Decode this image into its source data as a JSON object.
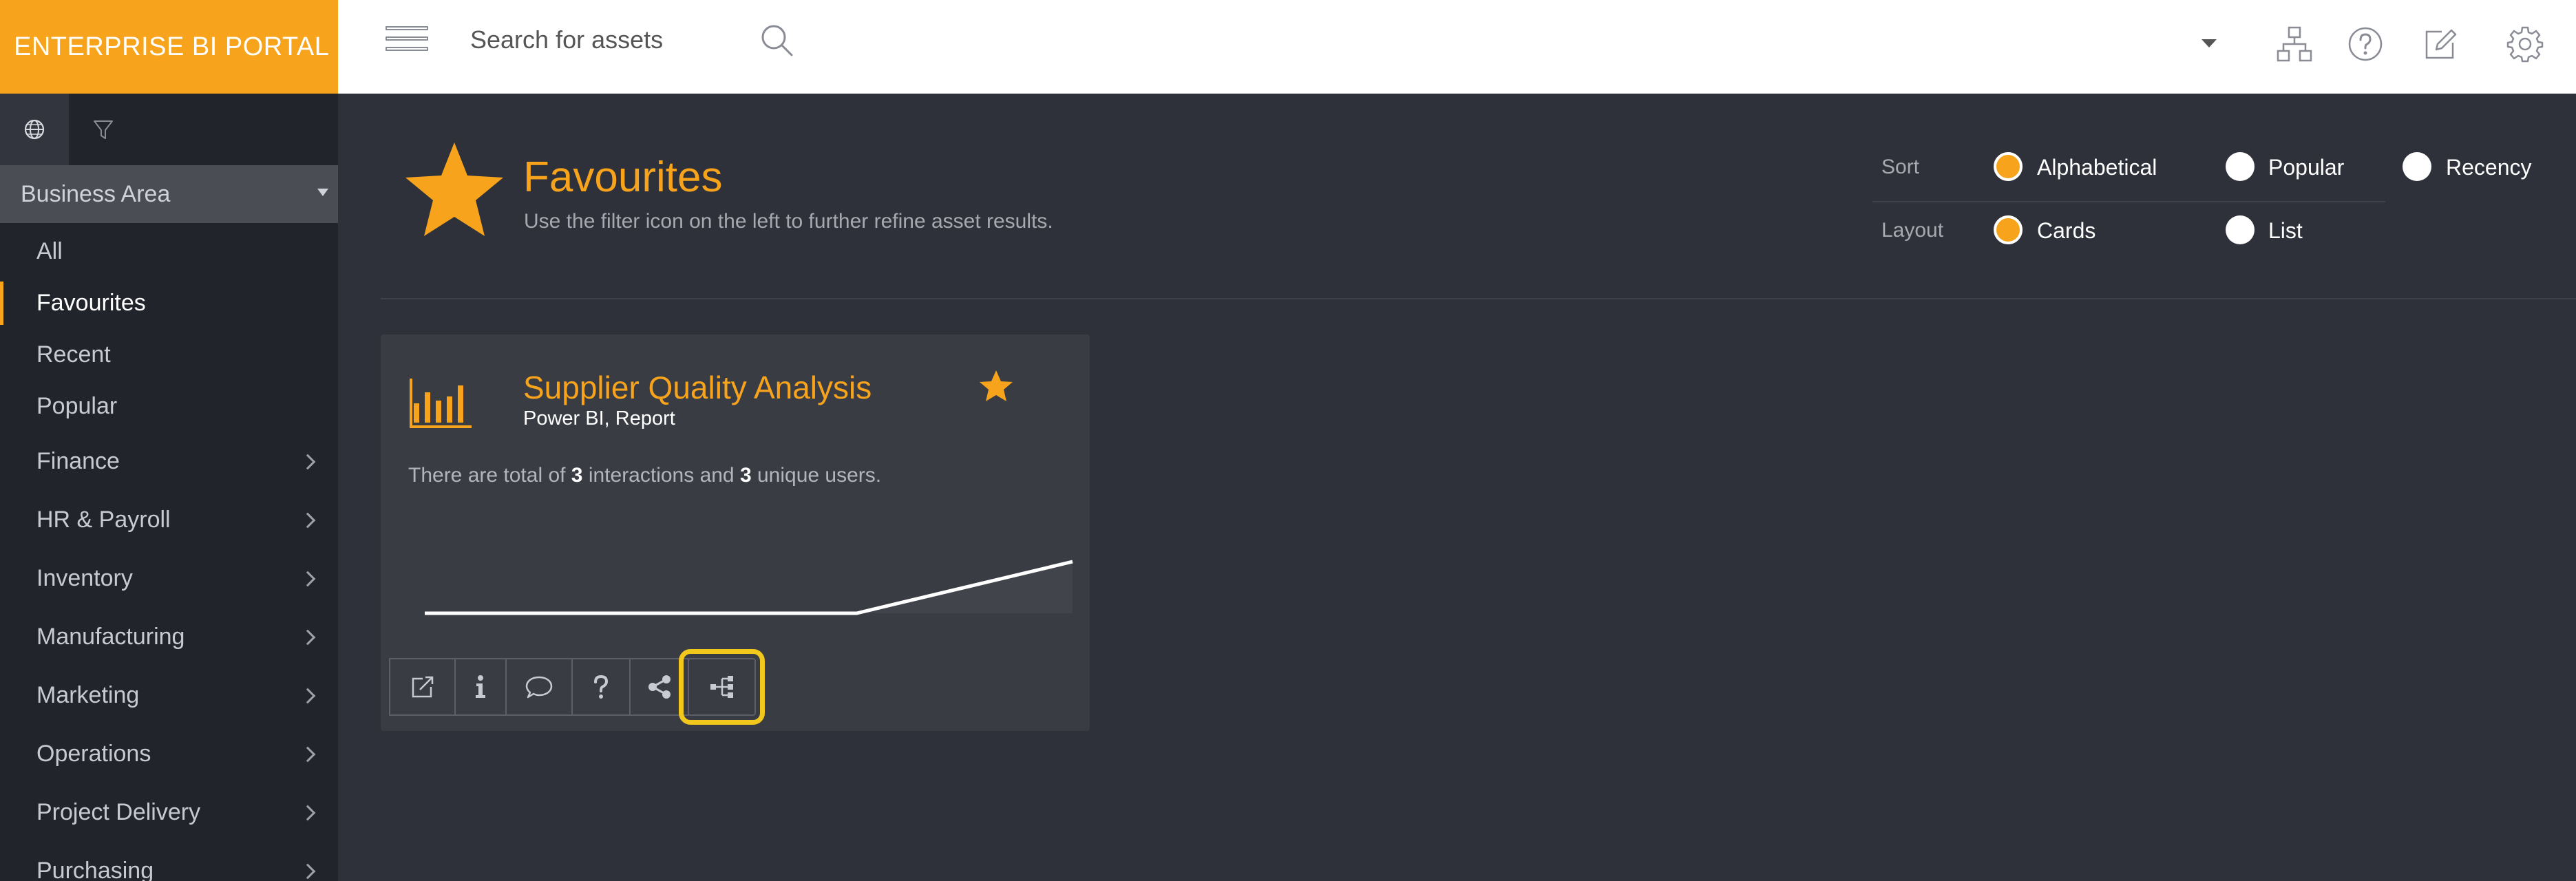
{
  "app": {
    "title": "ENTERPRISE BI PORTAL"
  },
  "header": {
    "search_placeholder": "Search for assets",
    "icons": [
      "menu-icon",
      "search-icon",
      "dropdown-caret-icon",
      "sitemap-icon",
      "help-icon",
      "edit-icon",
      "settings-icon"
    ]
  },
  "sidebar": {
    "tabs": [
      "globe-icon",
      "filter-icon"
    ],
    "area_select": "Business Area",
    "items": [
      {
        "label": "All",
        "active": false,
        "group": false
      },
      {
        "label": "Favourites",
        "active": true,
        "group": false
      },
      {
        "label": "Recent",
        "active": false,
        "group": false
      },
      {
        "label": "Popular",
        "active": false,
        "group": false
      },
      {
        "label": "Finance",
        "active": false,
        "group": true
      },
      {
        "label": "HR & Payroll",
        "active": false,
        "group": true
      },
      {
        "label": "Inventory",
        "active": false,
        "group": true
      },
      {
        "label": "Manufacturing",
        "active": false,
        "group": true
      },
      {
        "label": "Marketing",
        "active": false,
        "group": true
      },
      {
        "label": "Operations",
        "active": false,
        "group": true
      },
      {
        "label": "Project Delivery",
        "active": false,
        "group": true
      },
      {
        "label": "Purchasing",
        "active": false,
        "group": true
      }
    ]
  },
  "page": {
    "title": "Favourites",
    "subtitle": "Use the filter icon on the left to further refine asset results."
  },
  "options": {
    "sort": {
      "label": "Sort",
      "choices": [
        "Alphabetical",
        "Popular",
        "Recency"
      ],
      "selected": "Alphabetical"
    },
    "layout": {
      "label": "Layout",
      "choices": [
        "Cards",
        "List"
      ],
      "selected": "Cards"
    }
  },
  "card": {
    "title": "Supplier Quality Analysis",
    "subtitle": "Power BI, Report",
    "stats_prefix": "There are total of ",
    "interactions": "3",
    "stats_middle": " interactions and ",
    "unique_users": "3",
    "stats_suffix": " unique users.",
    "favourite": true,
    "sparkline": [
      0,
      0,
      0,
      1
    ],
    "actions": [
      "external-link-icon",
      "info-icon",
      "comment-icon",
      "question-icon",
      "share-icon",
      "lineage-icon"
    ],
    "highlighted_action": "lineage-icon"
  },
  "colors": {
    "accent": "#f7a41c",
    "highlight": "#f2c81c",
    "background": "#2f313a",
    "sidebar": "#22242b"
  }
}
